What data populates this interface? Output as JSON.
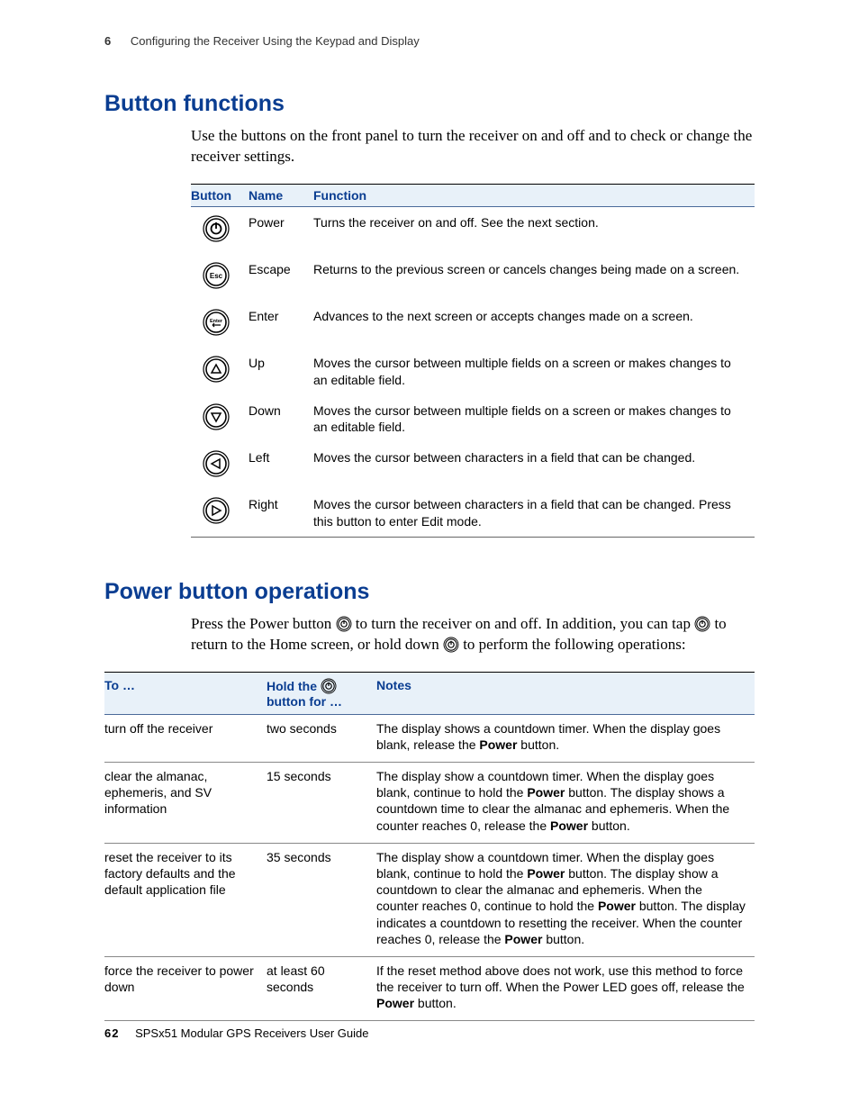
{
  "header": {
    "chapter_number": "6",
    "chapter_title": "Configuring the Receiver Using the Keypad and Display"
  },
  "section1": {
    "title": "Button functions",
    "intro": "Use the buttons on the front panel to turn the receiver on and off and to check or change the receiver settings.",
    "columns": {
      "c1": "Button",
      "c2": "Name",
      "c3": "Function"
    },
    "rows": [
      {
        "icon": "power",
        "name": "Power",
        "func": "Turns the receiver on and off. See the next section."
      },
      {
        "icon": "esc",
        "name": "Escape",
        "func": "Returns to the previous screen or cancels changes being made on a screen."
      },
      {
        "icon": "enter",
        "name": "Enter",
        "func": "Advances to the next screen or accepts changes made on a screen."
      },
      {
        "icon": "up",
        "name": "Up",
        "func": "Moves the cursor between multiple fields on a screen or makes changes to an editable field."
      },
      {
        "icon": "down",
        "name": "Down",
        "func": "Moves the cursor between multiple fields on a screen or makes changes to an editable field."
      },
      {
        "icon": "left",
        "name": "Left",
        "func": "Moves the cursor between characters in a field that can be changed."
      },
      {
        "icon": "right",
        "name": "Right",
        "func": "Moves the cursor between characters in a field that can be changed. Press this button to enter Edit mode."
      }
    ]
  },
  "section2": {
    "title": "Power button operations",
    "intro_a": "Press the Power button ",
    "intro_b": " to turn the receiver on and off. In addition, you can tap ",
    "intro_c": " to return to the Home screen, or hold down ",
    "intro_d": " to perform the following operations:",
    "columns": {
      "c1": "To …",
      "c2a": "Hold the ",
      "c2b": " button for …",
      "c3": "Notes"
    },
    "rows": [
      {
        "to": "turn off the receiver",
        "hold": "two seconds",
        "note_parts": [
          "The display shows a countdown timer. When the display goes blank, release the ",
          "Power",
          " button."
        ]
      },
      {
        "to": "clear the almanac, ephemeris, and SV information",
        "hold": "15 seconds",
        "note_parts": [
          "The display show a countdown timer. When the display goes blank, continue to hold the ",
          "Power",
          " button. The display shows a countdown time to clear the almanac and ephemeris. When the counter reaches 0, release the ",
          "Power",
          " button."
        ]
      },
      {
        "to": "reset the receiver to its factory defaults and the default application file",
        "hold": "35 seconds",
        "note_parts": [
          "The display show a countdown timer. When the display goes blank, continue to hold the ",
          "Power",
          " button. The display show a countdown to clear the almanac and ephemeris. When the counter reaches 0, continue to hold the ",
          "Power",
          " button. The display indicates a countdown to resetting the receiver. When the counter reaches 0, release the ",
          "Power",
          " button."
        ]
      },
      {
        "to": "force the receiver to power down",
        "hold": "at least 60 seconds",
        "note_parts": [
          "If the reset method above does not work, use this method to force the receiver to turn off. When the Power LED goes off, release the ",
          "Power",
          " button."
        ]
      }
    ]
  },
  "footer": {
    "page": "62",
    "doc": "SPSx51 Modular GPS Receivers User Guide"
  }
}
